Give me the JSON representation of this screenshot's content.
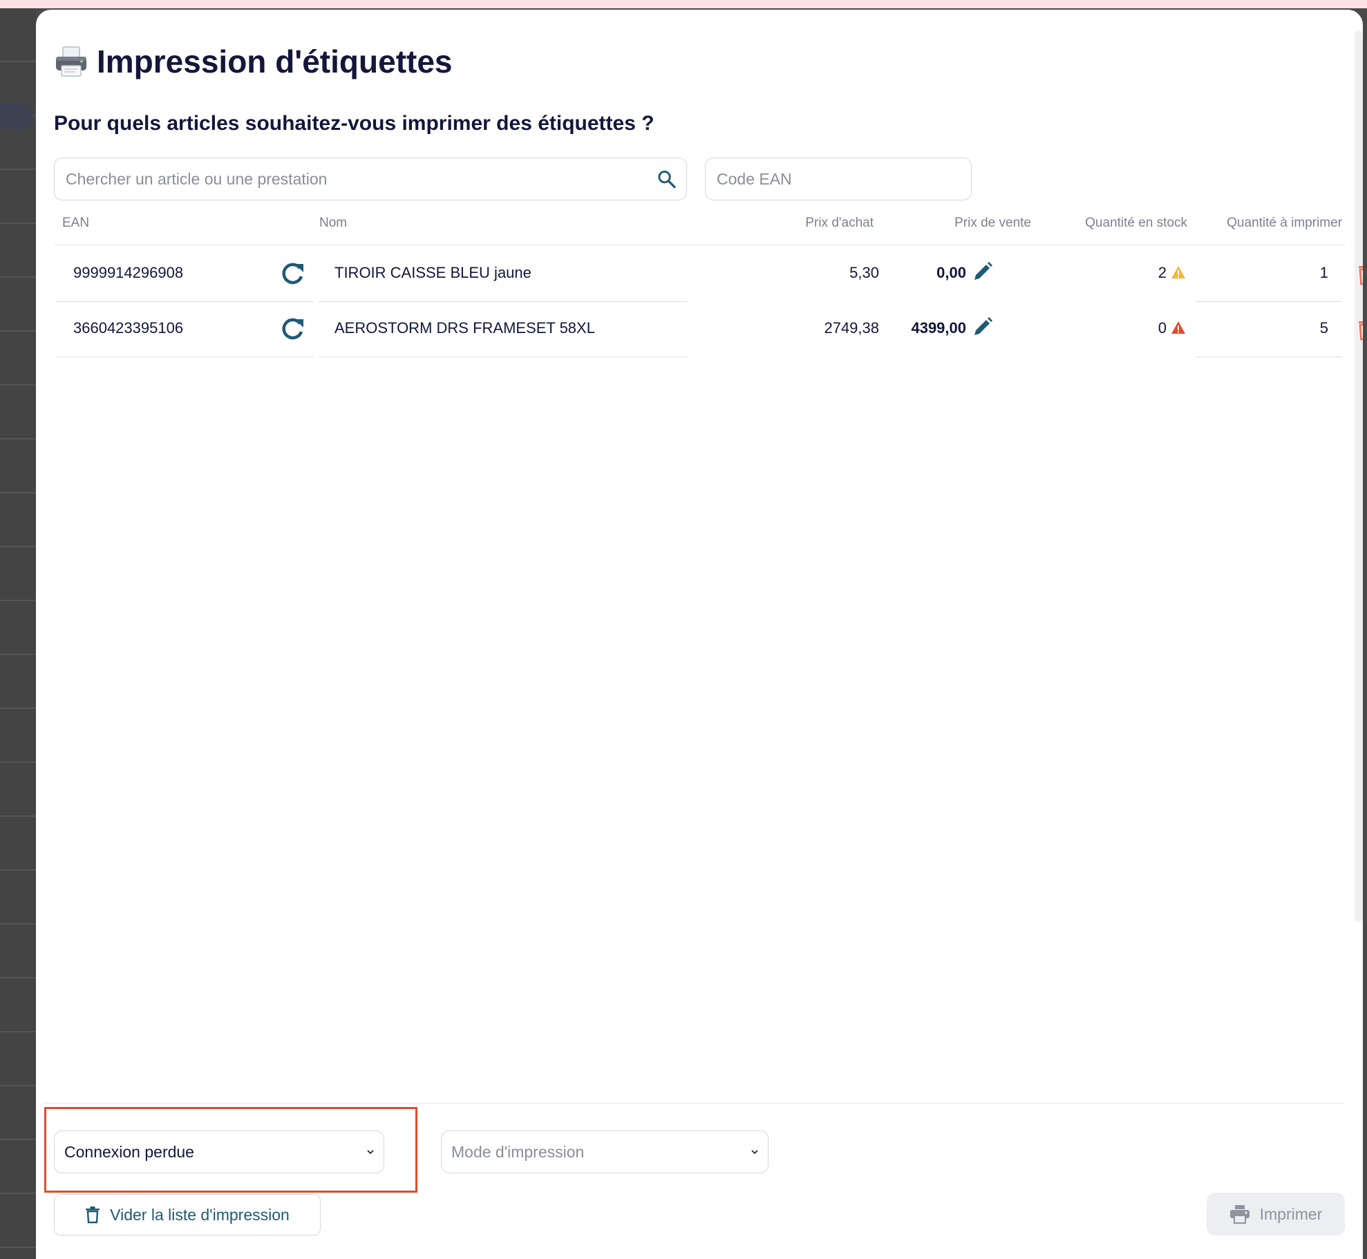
{
  "modal": {
    "title": "Impression d'étiquettes",
    "subtitle": "Pour quels articles souhaitez-vous imprimer des étiquettes ?"
  },
  "search": {
    "placeholder": "Chercher un article ou une prestation",
    "value": ""
  },
  "ean_input": {
    "placeholder": "Code EAN",
    "value": ""
  },
  "table": {
    "headers": {
      "ean": "EAN",
      "name": "Nom",
      "purchase_price": "Prix d'achat",
      "sale_price": "Prix de vente",
      "stock_qty": "Quantité en stock",
      "print_qty": "Quantité à imprimer"
    },
    "rows": [
      {
        "ean": "9999914296908",
        "name": "TIROIR CAISSE BLEU jaune",
        "purchase_price": "5,30",
        "sale_price": "0,00",
        "stock_qty": "2",
        "stock_alert": "warning",
        "print_qty": "1"
      },
      {
        "ean": "3660423395106",
        "name": "AEROSTORM DRS FRAMESET 58XL",
        "purchase_price": "2749,38",
        "sale_price": "4399,00",
        "stock_qty": "0",
        "stock_alert": "danger",
        "print_qty": "5"
      }
    ]
  },
  "footer": {
    "connection_select": {
      "value": "Connexion perdue"
    },
    "mode_select": {
      "placeholder": "Mode d'impression"
    },
    "clear_button": "Vider la liste d'impression",
    "print_button": "Imprimer"
  },
  "colors": {
    "title": "#14163a",
    "accent": "#1f5a75",
    "delete": "#e8735e",
    "warning": "#f2b73b",
    "danger": "#e04b2e",
    "highlight": "#e04b2e"
  },
  "icons": {
    "title": "printer-icon",
    "search": "search-icon",
    "refresh": "refresh-icon",
    "edit": "pencil-icon",
    "warning": "warning-triangle-icon",
    "delete": "trash-icon",
    "dropdown": "chevron-down-icon",
    "print": "printer-icon"
  }
}
